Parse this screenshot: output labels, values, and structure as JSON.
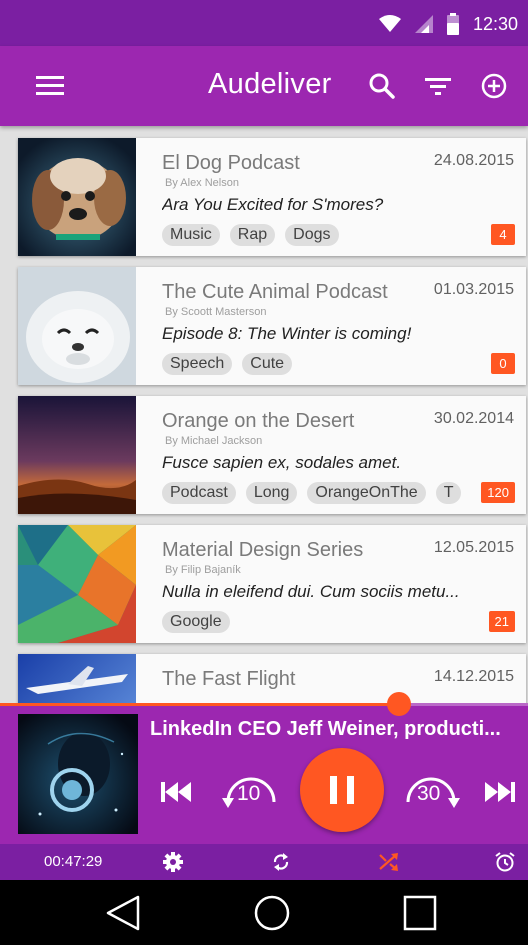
{
  "status_bar": {
    "time": "12:30"
  },
  "app_bar": {
    "title": "Audeliver"
  },
  "podcasts": [
    {
      "title": "El Dog Podcast",
      "author": "By Alex Nelson",
      "date": "24.08.2015",
      "episode": "Ara You Excited for S'mores?",
      "tags": [
        "Music",
        "Rap",
        "Dogs"
      ],
      "count": "4"
    },
    {
      "title": "The Cute Animal Podcast",
      "author": "By Scoott Masterson",
      "date": "01.03.2015",
      "episode": "Episode 8: The Winter is coming!",
      "tags": [
        "Speech",
        "Cute"
      ],
      "count": "0"
    },
    {
      "title": "Orange on the Desert",
      "author": "By Michael Jackson",
      "date": "30.02.2014",
      "episode": "Fusce sapien ex, sodales amet.",
      "tags": [
        "Podcast",
        "Long",
        "OrangeOnThe",
        "T"
      ],
      "count": "120"
    },
    {
      "title": "Material Design Series",
      "author": "By Filip Bajaník",
      "date": "12.05.2015",
      "episode": "Nulla in eleifend dui. Cum sociis metu...",
      "tags": [
        "Google"
      ],
      "count": "21"
    },
    {
      "title": "The Fast Flight",
      "date": "14.12.2015"
    }
  ],
  "player": {
    "now_playing": "LinkedIn CEO Jeff Weiner, producti...",
    "rewind_label": "10",
    "forward_label": "30",
    "progress_fraction": 0.755,
    "elapsed": "00:47:29"
  },
  "colors": {
    "primary": "#9c27b0",
    "primary_dark": "#7b1fa2",
    "accent": "#ff5722"
  }
}
